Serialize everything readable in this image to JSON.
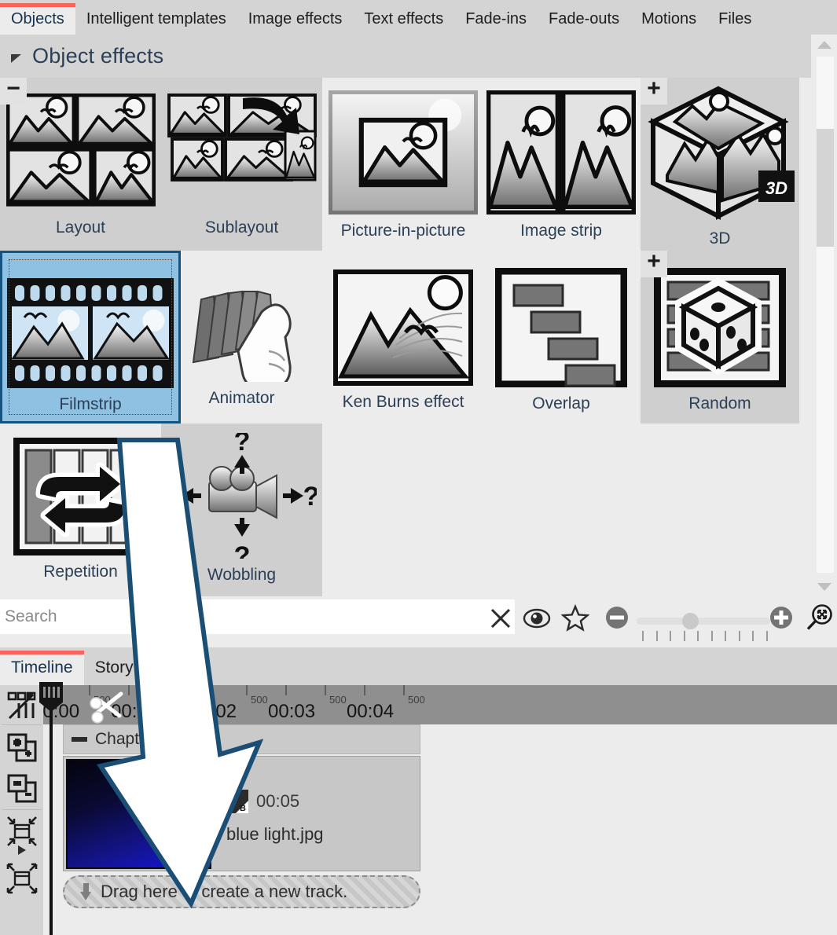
{
  "tabs": [
    {
      "label": "Objects",
      "active": true
    },
    {
      "label": "Intelligent templates",
      "active": false
    },
    {
      "label": "Image effects",
      "active": false
    },
    {
      "label": "Text effects",
      "active": false
    },
    {
      "label": "Fade-ins",
      "active": false
    },
    {
      "label": "Fade-outs",
      "active": false
    },
    {
      "label": "Motions",
      "active": false
    },
    {
      "label": "Files",
      "active": false
    }
  ],
  "panel": {
    "title": "Object effects",
    "collapse_icon": "triangle-collapse-icon"
  },
  "effects": [
    {
      "label": "Layout",
      "badge": "−",
      "group": true,
      "selected": false,
      "icon": "layout-icon"
    },
    {
      "label": "Sublayout",
      "badge": "",
      "group": true,
      "selected": false,
      "icon": "sublayout-icon"
    },
    {
      "label": "Picture-in-picture",
      "badge": "",
      "group": false,
      "selected": false,
      "icon": "picture-in-picture-icon"
    },
    {
      "label": "Image strip",
      "badge": "",
      "group": false,
      "selected": false,
      "icon": "image-strip-icon"
    },
    {
      "label": "3D",
      "badge": "+",
      "group": true,
      "selected": false,
      "icon": "cube-3d-icon"
    },
    {
      "label": "Filmstrip",
      "badge": "",
      "group": false,
      "selected": true,
      "icon": "filmstrip-icon"
    },
    {
      "label": "Animator",
      "badge": "",
      "group": false,
      "selected": false,
      "icon": "animator-hand-icon"
    },
    {
      "label": "Ken Burns effect",
      "badge": "",
      "group": false,
      "selected": false,
      "icon": "ken-burns-icon"
    },
    {
      "label": "Overlap",
      "badge": "",
      "group": false,
      "selected": false,
      "icon": "overlap-icon"
    },
    {
      "label": "Random",
      "badge": "+",
      "group": true,
      "selected": false,
      "icon": "random-dice-icon"
    },
    {
      "label": "Repetition",
      "badge": "",
      "group": false,
      "selected": false,
      "icon": "repetition-loop-icon"
    },
    {
      "label": "Wobbling",
      "badge": "",
      "group": true,
      "selected": false,
      "icon": "wobbling-camera-icon"
    }
  ],
  "search": {
    "placeholder": "Search",
    "value": "",
    "clear_icon": "close-x-icon",
    "preview_icon": "eye-icon",
    "favorite_icon": "star-icon",
    "zoom_out_icon": "minus-circle-icon",
    "zoom_in_icon": "plus-circle-icon",
    "fit_icon": "magnifier-fit-icon",
    "slider_value": 35
  },
  "timeline": {
    "tabs": [
      {
        "label": "Timeline",
        "active": true
      },
      {
        "label": "Storyboard",
        "active": false
      }
    ],
    "tools": [
      {
        "name": "split-mode-icon"
      },
      {
        "name": "add-track-icon"
      },
      {
        "name": "remove-track-icon"
      },
      {
        "name": "shrink-track-icon"
      },
      {
        "name": "expand-track-icon"
      }
    ],
    "ruler": {
      "labels": [
        "00:00",
        "00:01",
        "00:02",
        "00:03",
        "00:04"
      ],
      "subticks": [
        "500",
        "500",
        "500",
        "500",
        "500"
      ]
    },
    "chapter": {
      "label": "Chapter 1",
      "collapse_icon": "minus-icon"
    },
    "clip": {
      "duration": "00:05",
      "filename": "blue light.jpg",
      "transition_icon": "ab-transition-icon",
      "transition_a": "A",
      "transition_b": "B"
    },
    "new_track": {
      "label": "Drag here to create a new track.",
      "icon": "arrow-down-icon"
    }
  },
  "colors": {
    "accent": "#f9635c",
    "selection_fill": "#8fc1e3",
    "selection_border": "#14527f",
    "label_text": "#2b3f56",
    "panel_bg": "#ececec",
    "chrome_bg": "#d4d4d4",
    "ruler_bg": "#8f8f8f"
  },
  "overlay": {
    "drag_arrow": "drag-arrow-annotation"
  }
}
